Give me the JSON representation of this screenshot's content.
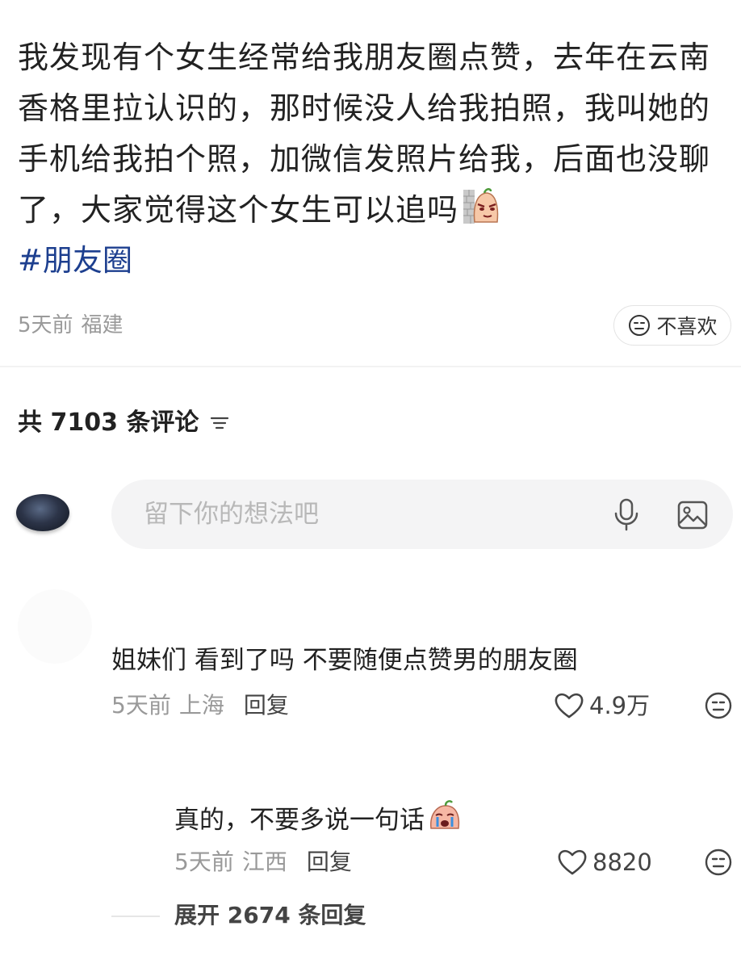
{
  "post": {
    "text": "我发现有个女生经常给我朋友圈点赞，去年在云南香格里拉认识的，那时候没人给我拍照，我叫她的手机给我拍个照，加微信发照片给我，后面也没聊了，大家觉得这个女生可以追吗",
    "emoji": "peeking-peach-emoji",
    "hashtag": "#朋友圈",
    "time": "5天前",
    "location": "福建",
    "dislike_label": "不喜欢"
  },
  "comments_header": {
    "label": "共 7103 条评论"
  },
  "comment_input": {
    "placeholder": "留下你的想法吧"
  },
  "comments": [
    {
      "text": "姐妹们 看到了吗 不要随便点赞男的朋友圈",
      "time": "5天前",
      "location": "上海",
      "reply_label": "回复",
      "likes": "4.9万",
      "replies": [
        {
          "text": "真的，不要多说一句话",
          "emoji": "crying-peach-emoji",
          "time": "5天前",
          "location": "江西",
          "reply_label": "回复",
          "likes": "8820"
        }
      ],
      "expand_label": "展开 2674 条回复"
    }
  ],
  "colors": {
    "hashtag": "#1d3f8f",
    "meta": "#999999",
    "input_bg": "#f4f4f5"
  }
}
